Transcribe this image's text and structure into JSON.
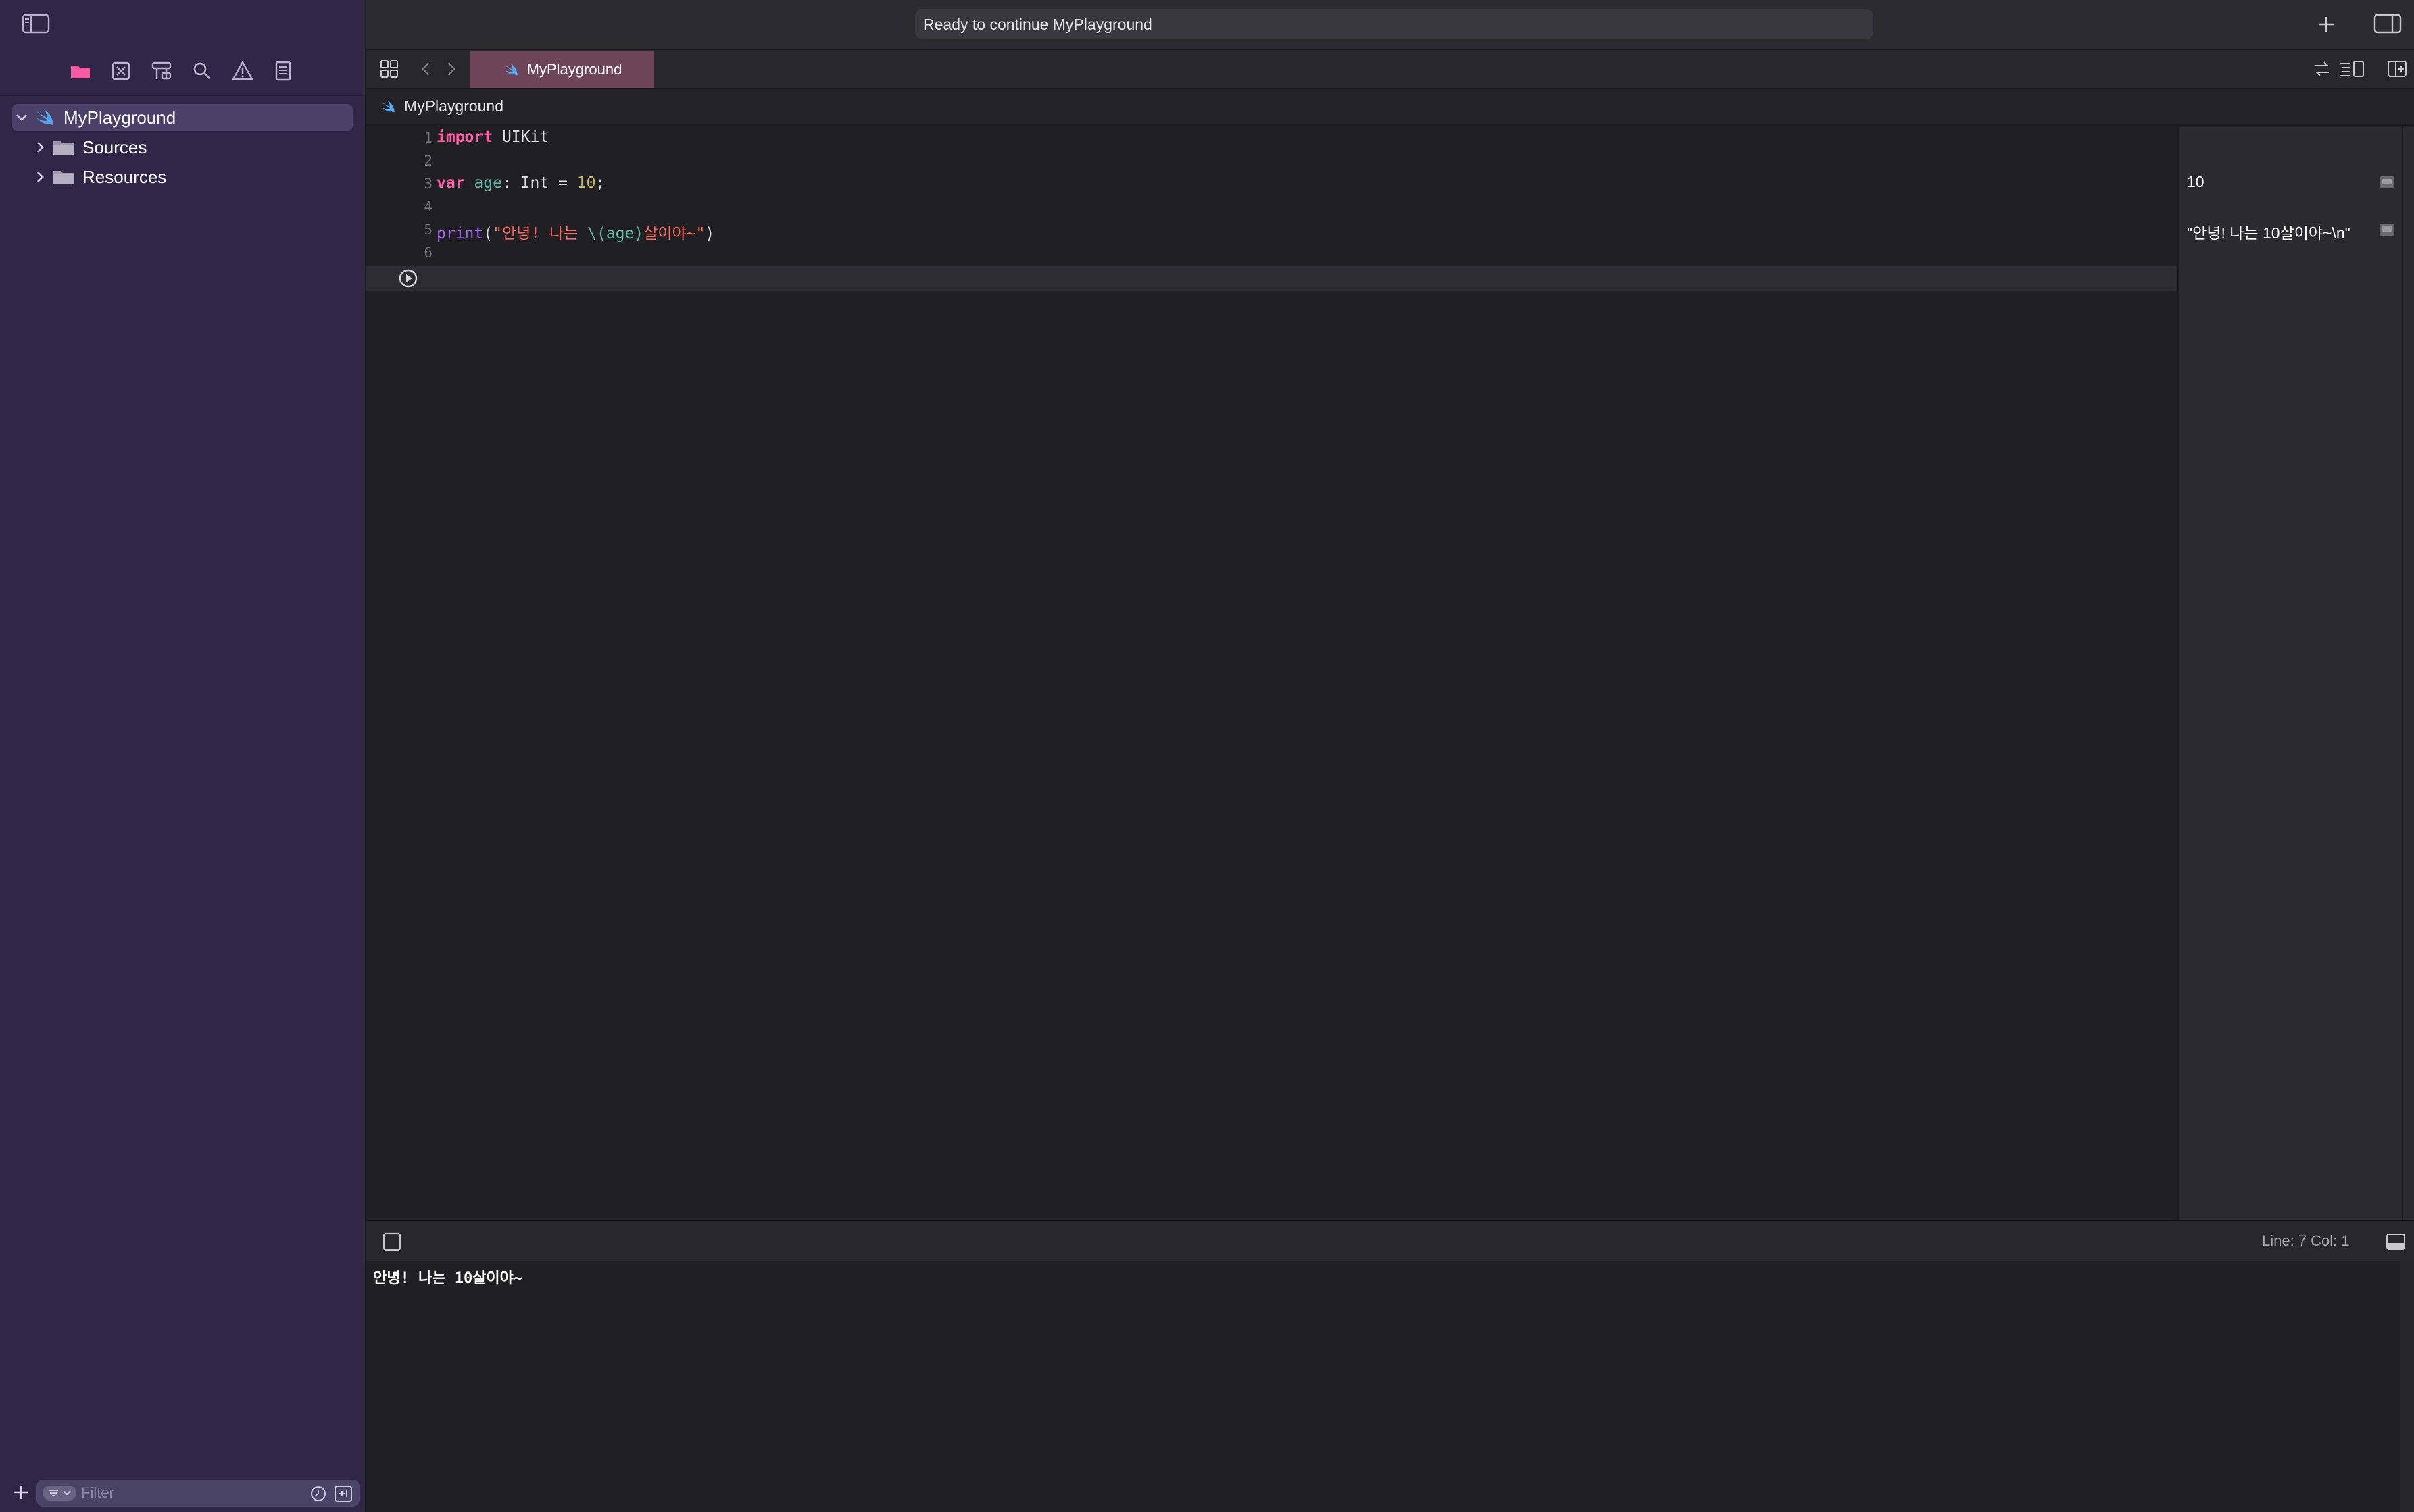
{
  "window": {
    "status": "Ready to continue MyPlayground"
  },
  "tab": {
    "label": "MyPlayground"
  },
  "breadcrumb": {
    "label": "MyPlayground"
  },
  "navigator": {
    "tools": [
      "folder-icon",
      "source-control-icon",
      "symbol-icon",
      "search-icon",
      "issue-icon",
      "report-icon"
    ],
    "tree": [
      {
        "label": "MyPlayground",
        "expanded": true,
        "selected": true
      },
      {
        "label": "Sources",
        "expanded": false
      },
      {
        "label": "Resources",
        "expanded": false
      }
    ],
    "filter_placeholder": "Filter"
  },
  "editor": {
    "lines": [
      {
        "n": "1"
      },
      {
        "n": "2"
      },
      {
        "n": "3"
      },
      {
        "n": "4"
      },
      {
        "n": "5"
      },
      {
        "n": "6"
      }
    ],
    "code": {
      "l1_kw": "import",
      "l1_rest": " UIKit",
      "l3_kw": "var",
      "l3_id": "age",
      "l3_colon": ": Int = ",
      "l3_num": "10",
      "l3_end": ";",
      "l5_fn": "print",
      "l5_open": "(",
      "l5_str1": "\"안녕! 나는 ",
      "l5_interp": "\\(age)",
      "l5_str2": "살이야~\"",
      "l5_close": ")"
    }
  },
  "results": {
    "line3": "10",
    "line5": "\"안녕! 나는 10살이야~\\n\""
  },
  "debug": {
    "line_col": "Line: 7  Col: 1"
  },
  "console": {
    "output": "안녕! 나는 10살이야~"
  },
  "colors": {
    "sidebar": "#2f2648",
    "tab_active": "#6e4458",
    "keyword": "#fc5fa3",
    "string": "#fc6a5d",
    "number": "#d0bf69"
  }
}
